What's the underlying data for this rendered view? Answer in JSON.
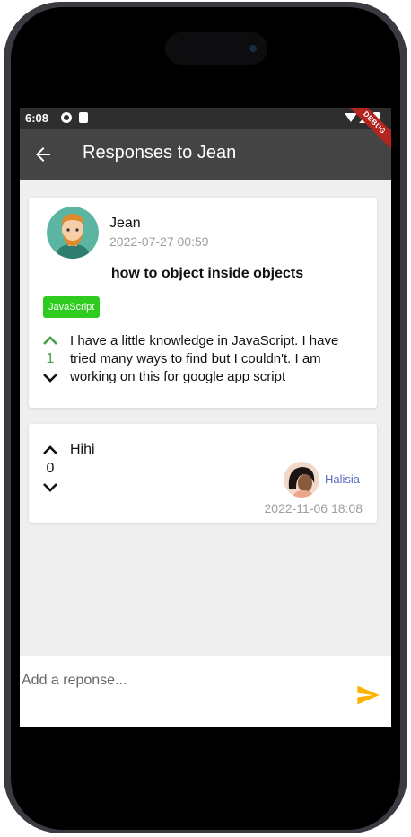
{
  "status_bar": {
    "time": "6:08",
    "debug_label": "DEBUG"
  },
  "app_bar": {
    "title": "Responses to Jean",
    "back_icon": "arrow-back-icon"
  },
  "question": {
    "author": "Jean",
    "date": "2022-07-27 00:59",
    "title": "how to object inside objects",
    "tag": "JavaScript",
    "votes": "1",
    "body": "I have a little knowledge in JavaScript. I have tried many ways to find but I couldn't. I am working on this for google app script"
  },
  "responses": [
    {
      "text": "Hihi",
      "votes": "0",
      "author": "Halisia",
      "date": "2022-11-06 18:08"
    }
  ],
  "reply": {
    "placeholder": "Add a reponse...",
    "send_icon": "send-icon"
  },
  "colors": {
    "app_bar": "#444444",
    "accent_green": "#2ecc1f",
    "vote_green": "#43a047",
    "send_yellow": "#ffb300",
    "author_link": "#5c6bc0"
  }
}
